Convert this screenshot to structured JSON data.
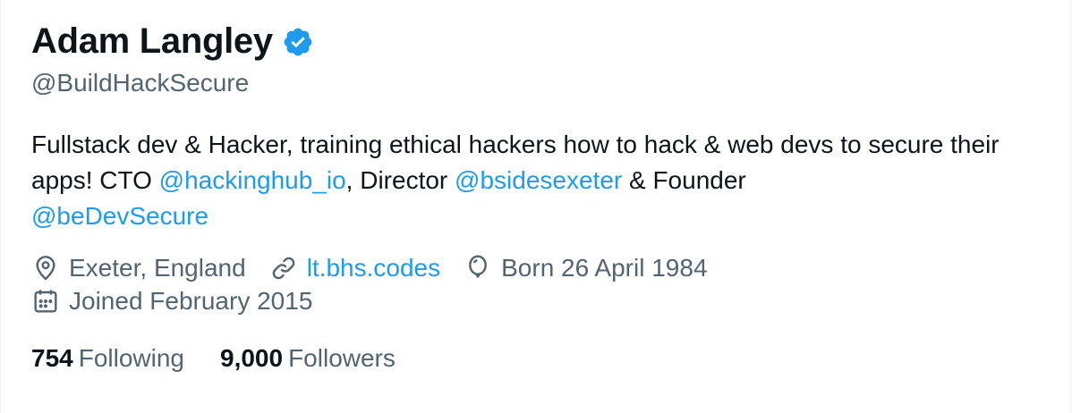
{
  "profile": {
    "display_name": "Adam Langley",
    "verified_icon": "verified-badge-icon",
    "handle": "@BuildHackSecure",
    "accent_color": "#1d9bf0"
  },
  "bio": {
    "t1": "Fullstack dev & Hacker, training ethical hackers how to hack & web devs to secure their apps! CTO ",
    "m1": "@hackinghub_io",
    "t2": ", Director ",
    "m2": "@bsidesexeter",
    "t3": " & Founder ",
    "m3": "@beDevSecure"
  },
  "meta": {
    "location": "Exeter, England",
    "location_icon": "location-pin-icon",
    "website": "lt.bhs.codes",
    "website_icon": "link-icon",
    "birthday": "Born 26 April 1984",
    "birthday_icon": "balloon-icon",
    "joined": "Joined February 2015",
    "joined_icon": "calendar-icon"
  },
  "stats": {
    "following_count": "754",
    "following_label": "Following",
    "followers_count": "9,000",
    "followers_label": "Followers"
  }
}
